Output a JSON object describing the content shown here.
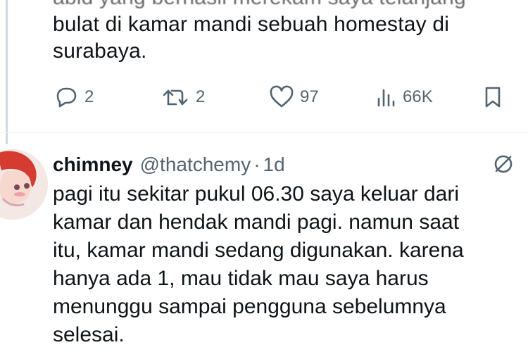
{
  "previous_tweet": {
    "faded_line": "abid yang berhasil merekam saya telanjang",
    "lines": [
      "bulat di kamar mandi sebuah homestay di",
      "surabaya."
    ],
    "actions": {
      "replies": "2",
      "retweets": "2",
      "likes": "97",
      "views": "66K"
    },
    "icons": [
      "reply-icon",
      "retweet-icon",
      "like-icon",
      "views-icon",
      "bookmark-icon"
    ]
  },
  "reply_tweet": {
    "author_name": "chimney",
    "handle": "@thatchemy",
    "separator": "·",
    "time": "1d",
    "lines": [
      "pagi itu sekitar pukul 06.30 saya keluar dari",
      "kamar dan hendak mandi pagi. namun saat",
      "itu, kamar mandi sedang digunakan. karena",
      "hanya ada 1, mau tidak mau saya harus",
      "menunggu sampai pengguna sebelumnya",
      "selesai."
    ]
  },
  "colors": {
    "text": "#0f1419",
    "muted": "#536471",
    "line": "#cfd9de"
  }
}
